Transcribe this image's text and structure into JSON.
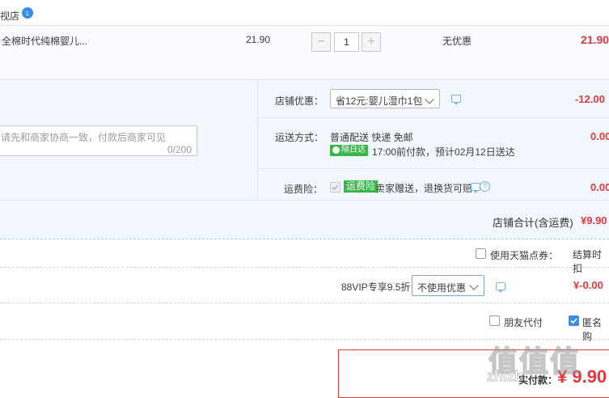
{
  "shop": {
    "name": "视店"
  },
  "item": {
    "title": "全棉时代纯棉婴儿...",
    "price": "21.90",
    "quantity": "1",
    "discount": "无优惠",
    "subtotal": "21.90"
  },
  "note": {
    "placeholder": "请先和商家协商一致，付款后商家可见",
    "counter": "0/200"
  },
  "shop_promo": {
    "label": "店铺优惠：",
    "selected": "省12元:婴儿湿巾1包",
    "amount": "-12.00"
  },
  "shipping": {
    "label": "运送方式：",
    "method": "普通配送 快递 免邮",
    "badge": "隔日达",
    "eta": "17:00前付款，预计02月12日送达",
    "amount": "0.00"
  },
  "insurance": {
    "label": "运费险：",
    "tag": "运费险",
    "text": "卖家赠送，退换货可赔",
    "amount": "0.00"
  },
  "shop_total": {
    "label": "店铺合计(含运费)",
    "value": "¥9.90"
  },
  "tmall_points": {
    "label": "使用天猫点券：",
    "right_text": "结算时扣"
  },
  "vip": {
    "label": "88VIP专享9.5折",
    "selected": "不使用优惠",
    "amount": "¥-0.00"
  },
  "options": {
    "friend_pay": "朋友代付",
    "anonymous": "匿名购"
  },
  "actual_pay": {
    "label": "实付款：",
    "value": "¥ 9.90"
  },
  "watermark": {
    "text": "值 值 值",
    "site": "zhizhi"
  },
  "colors": {
    "price_red": "#e4393c",
    "section_bg": "#f2f7fd",
    "border_blue": "#b0c9e2",
    "link_blue": "#3a8ee6"
  }
}
